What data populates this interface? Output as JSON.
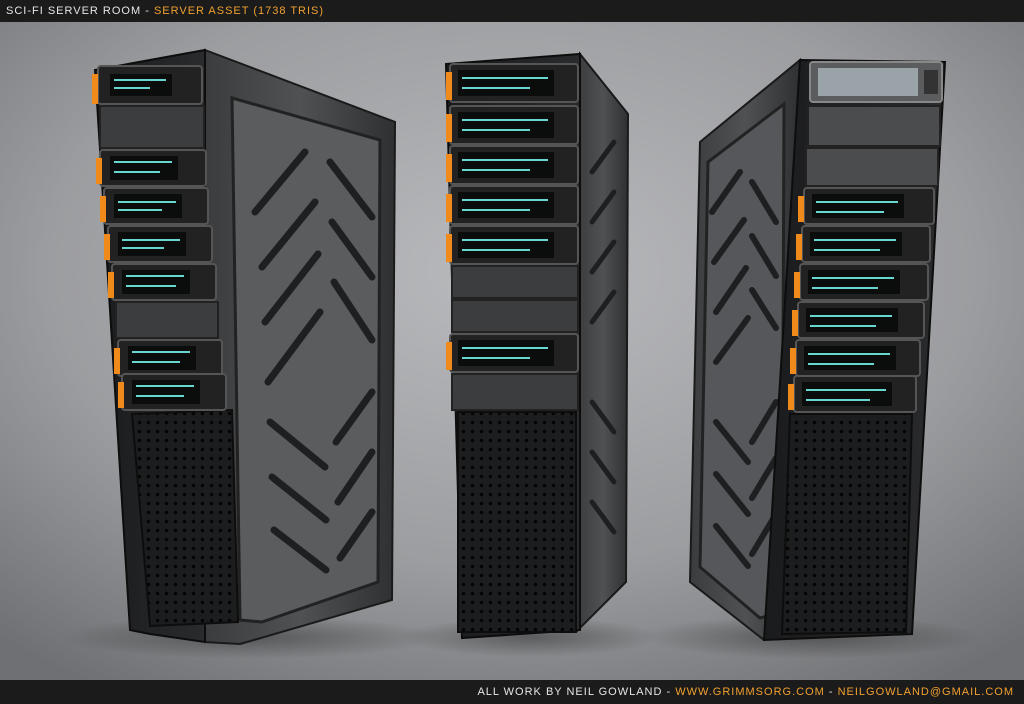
{
  "header": {
    "title_prefix": "SCI-FI SERVER ROOM",
    "separator": " - ",
    "title_accent": "SERVER ASSET (1738 TRIS)"
  },
  "footer": {
    "credit": "ALL WORK BY NEIL GOWLAND",
    "sep1": " - ",
    "website": "WWW.GRIMMSORG.COM",
    "sep2": " - ",
    "email": "NEILGOWLAND@GMAIL.COM"
  },
  "colors": {
    "bar_bg": "#1b1b1b",
    "accent": "#f0a030",
    "screen_glow": "#6ad6d0",
    "led_orange": "#f08a1a"
  }
}
